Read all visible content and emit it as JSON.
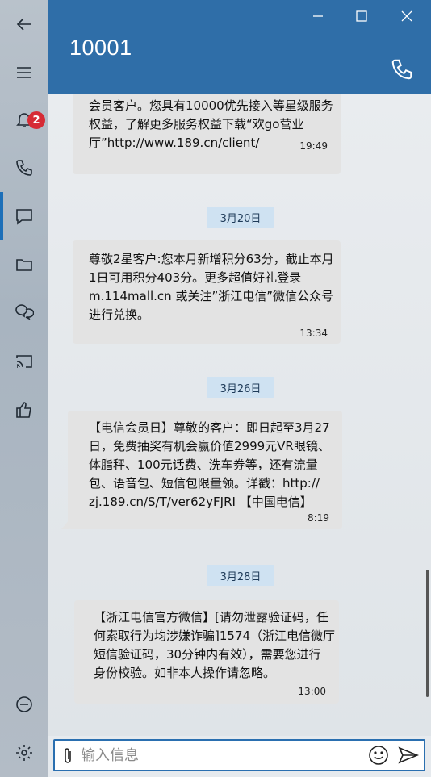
{
  "window": {
    "title": "10001"
  },
  "rail": {
    "notification_count": "2"
  },
  "messages": [
    {
      "text": "会员客户。您具有10000优先接入等星级服务\n权益，了解更多服务权益下载“欢go营业\n厅”http://www.189.cn/client/",
      "time": "19:49"
    },
    {
      "date": "3月20日"
    },
    {
      "text": "尊敬2星客户:您本月新增积分63分，截止本月\n1日可用积分403分。更多超值好礼登录\nm.114mall.cn 或关注”浙江电信”微信公众号\n进行兑换。",
      "time": "13:34"
    },
    {
      "date": "3月26日"
    },
    {
      "text": "【电信会员日】尊敬的客户：即日起至3月27\n日，免费抽奖有机会赢价值2999元VR眼镜、\n体脂秤、100元话费、洗车券等，还有流量\n包、语音包、短信包限量领。详戳：http://\nzj.189.cn/S/T/ver62yFJRI 【中国电信】",
      "time": "8:19"
    },
    {
      "date": "3月28日"
    },
    {
      "text": "【浙江电信官方微信】[请勿泄露验证码，任\n何索取行为均涉嫌诈骗]1574（浙江电信微厅\n短信验证码，30分钟内有效），需要您进行\n身份校验。如非本人操作请忽略。",
      "time": "13:00"
    }
  ],
  "input": {
    "placeholder": "输入信息"
  }
}
